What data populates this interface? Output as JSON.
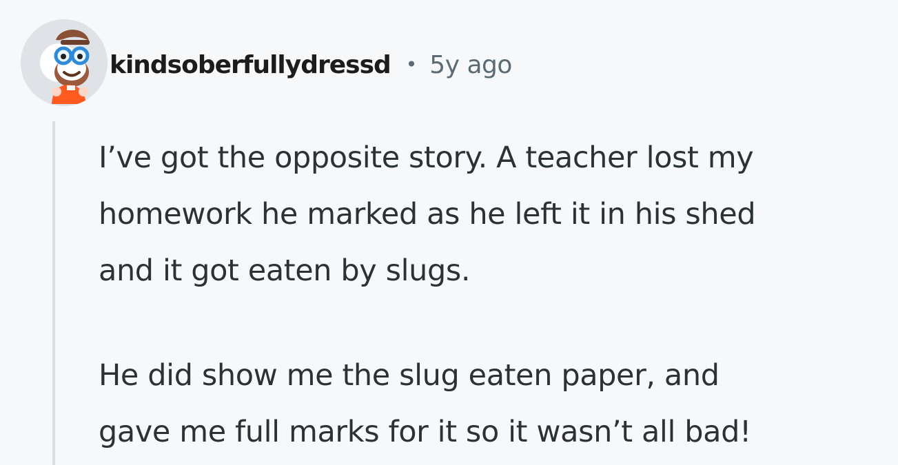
{
  "comment": {
    "avatar_icon": "snoo-avatar-with-glasses-beard-orange-shirt",
    "username": "kindsoberfullydressd",
    "separator": "•",
    "timestamp": "5y ago",
    "paragraphs": [
      "I’ve got the opposite story. A teacher lost my\nhomework he marked as he left it in his shed\nand it got eaten by slugs.",
      "He did show me the slug eaten paper, and\ngave me full marks for it so it wasn’t all bad!"
    ]
  },
  "colors": {
    "background": "#f7f8fa",
    "text": "#2a3236",
    "username": "#1c1c1c",
    "meta": "#5a6b74",
    "thread_line": "#d8e0e6",
    "avatar_shirt": "#ff5a1f"
  }
}
